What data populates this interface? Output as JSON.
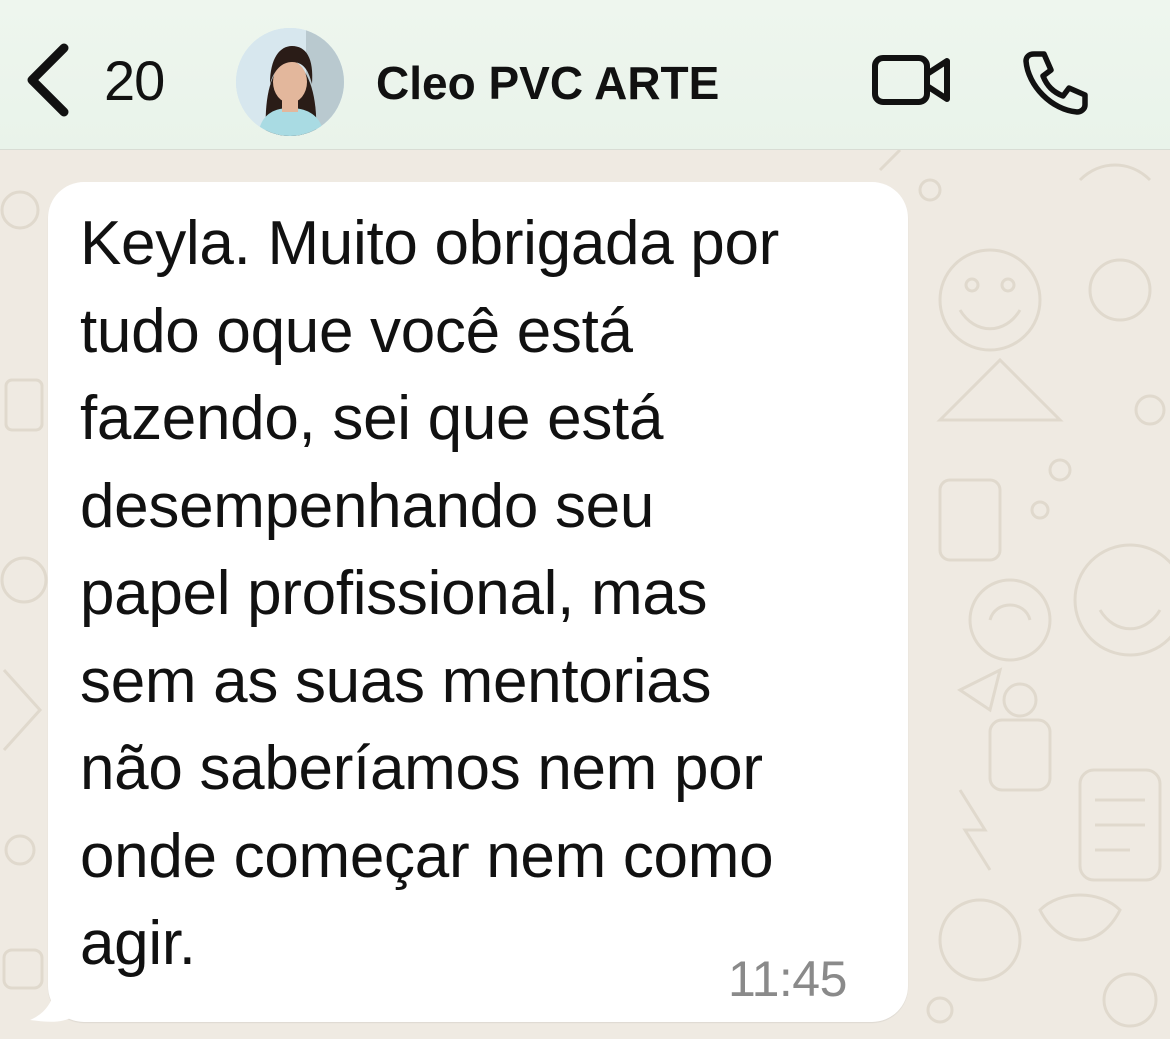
{
  "header": {
    "unread_count": "20",
    "contact_name": "Cleo PVC ARTE"
  },
  "message": {
    "text": "Keyla. Muito obrigada por\ntudo oque você está\nfazendo, sei que está\ndesempenhando seu\npapel profissional, mas\nsem as suas mentorias\nnão saberíamos nem por\nonde começar nem como\nagir.",
    "time": "11:45"
  },
  "icons": {
    "back": "chevron-left-icon",
    "video": "video-camera-icon",
    "phone": "phone-icon"
  },
  "colors": {
    "header_bg": "#e9f3ea",
    "chat_bg": "#efeae2",
    "bubble_bg": "#ffffff",
    "text": "#111111",
    "timestamp": "#8a8a8a"
  }
}
